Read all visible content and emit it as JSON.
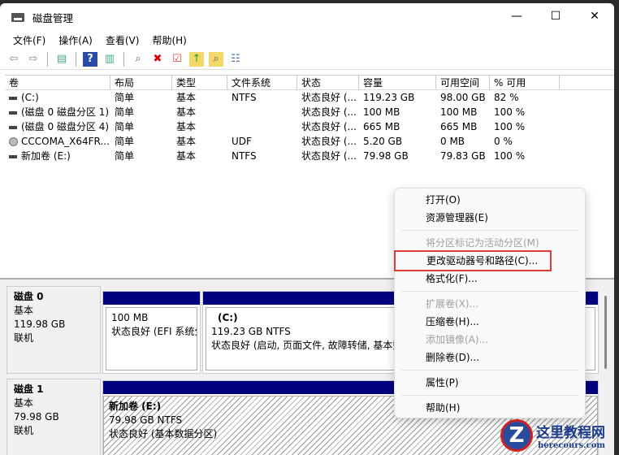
{
  "window": {
    "title": "磁盘管理",
    "minimize": "—",
    "maximize": "☐",
    "close": "✕"
  },
  "menu": [
    "文件(F)",
    "操作(A)",
    "查看(V)",
    "帮助(H)"
  ],
  "toolbar": [
    "back-icon",
    "forward-icon",
    "console-tree-icon",
    "help-icon",
    "show-pane-icon",
    "connect-disk-icon",
    "delete-icon",
    "properties-icon",
    "folder-up-icon",
    "search-folder-icon",
    "list-icon"
  ],
  "columns": [
    "卷",
    "布局",
    "类型",
    "文件系统",
    "状态",
    "容量",
    "可用空间",
    "% 可用"
  ],
  "volumes": [
    [
      "(C:)",
      "简单",
      "基本",
      "NTFS",
      "状态良好 (...",
      "119.23 GB",
      "98.00 GB",
      "82 %"
    ],
    [
      "(磁盘 0 磁盘分区 1)",
      "简单",
      "基本",
      "",
      "状态良好 (...",
      "100 MB",
      "100 MB",
      "100 %"
    ],
    [
      "(磁盘 0 磁盘分区 4)",
      "简单",
      "基本",
      "",
      "状态良好 (...",
      "665 MB",
      "665 MB",
      "100 %"
    ],
    [
      "CCCOMA_X64FR...",
      "简单",
      "基本",
      "UDF",
      "状态良好 (...",
      "5.20 GB",
      "0 MB",
      "0 %"
    ],
    [
      "新加卷 (E:)",
      "简单",
      "基本",
      "NTFS",
      "状态良好 (...",
      "79.98 GB",
      "79.83 GB",
      "100 %"
    ]
  ],
  "disks": [
    {
      "name": "磁盘 0",
      "type": "基本",
      "size": "119.98 GB",
      "status": "联机",
      "parts": [
        {
          "label": "",
          "size": "100 MB",
          "status": "状态良好 (EFI 系统分"
        },
        {
          "label": "(C:)",
          "size": "119.23 GB NTFS",
          "status": "状态良好 (启动, 页面文件, 故障转储, 基本数"
        }
      ]
    },
    {
      "name": "磁盘 1",
      "type": "基本",
      "size": "79.98 GB",
      "status": "联机",
      "parts": [
        {
          "label": "新加卷  (E:)",
          "size": "79.98 GB NTFS",
          "status": "状态良好 (基本数据分区)"
        }
      ]
    }
  ],
  "context_menu": {
    "items": [
      "打开(O)",
      "资源管理器(E)",
      "将分区标记为活动分区(M)",
      "更改驱动器号和路径(C)...",
      "格式化(F)...",
      "扩展卷(X)...",
      "压缩卷(H)...",
      "添加镜像(A)...",
      "删除卷(D)...",
      "属性(P)",
      "帮助(H)"
    ]
  },
  "watermark": {
    "name": "这里教程网",
    "url": "herecours.com"
  }
}
